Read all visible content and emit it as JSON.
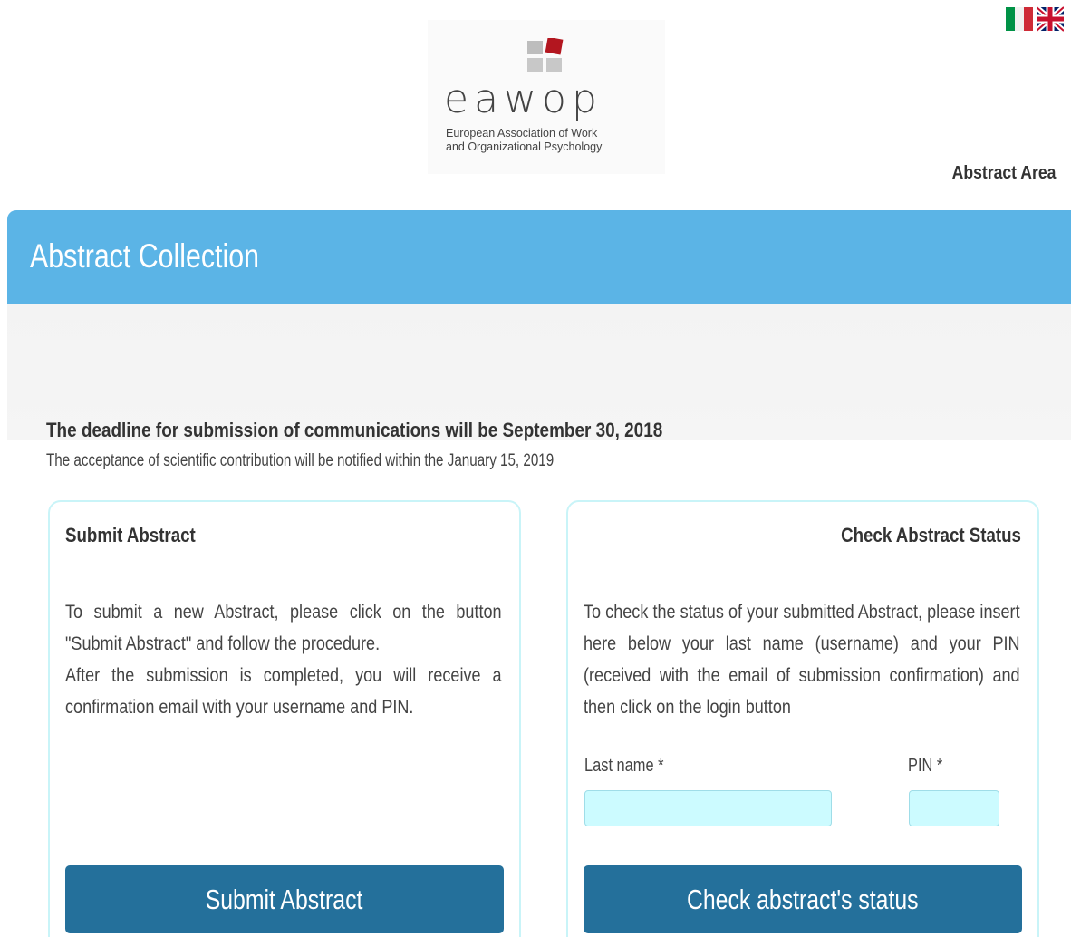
{
  "header": {
    "languages": [
      {
        "name": "Italian",
        "icon": "italian-flag-icon"
      },
      {
        "name": "English",
        "icon": "uk-flag-icon"
      }
    ],
    "logo": {
      "wordmark": "eawop",
      "subtitle_line1": "European Association of Work",
      "subtitle_line2": "and Organizational Psychology"
    },
    "area_title": "Abstract Area"
  },
  "banner": {
    "title": "Abstract Collection",
    "color": "#5bb4e6"
  },
  "notice": {
    "deadline": "The deadline for submission of communications will be September 30, 2018",
    "acceptance": "The acceptance of scientific contribution will be notified within the January 15, 2019"
  },
  "submit_card": {
    "title": "Submit Abstract",
    "text_1": "To submit a new Abstract, please click on the button \"Submit Abstract\" and follow the procedure.",
    "text_2": "After the submission is completed, you will receive a confirmation email with your username and PIN.",
    "button_label": "Submit Abstract"
  },
  "status_card": {
    "title": "Check Abstract Status",
    "text": "To check the status of your submitted Abstract, please insert here below your last name (username) and your PIN (received with the email of submission confirmation) and then click on the login button",
    "last_name_label": "Last name *",
    "last_name_value": "",
    "pin_label": "PIN *",
    "pin_value": "",
    "button_label": "Check abstract's status"
  },
  "colors": {
    "accent": "#5bb4e6",
    "button": "#24709b",
    "input_bg": "#ccfbff",
    "card_border": "#c9f4f8"
  }
}
